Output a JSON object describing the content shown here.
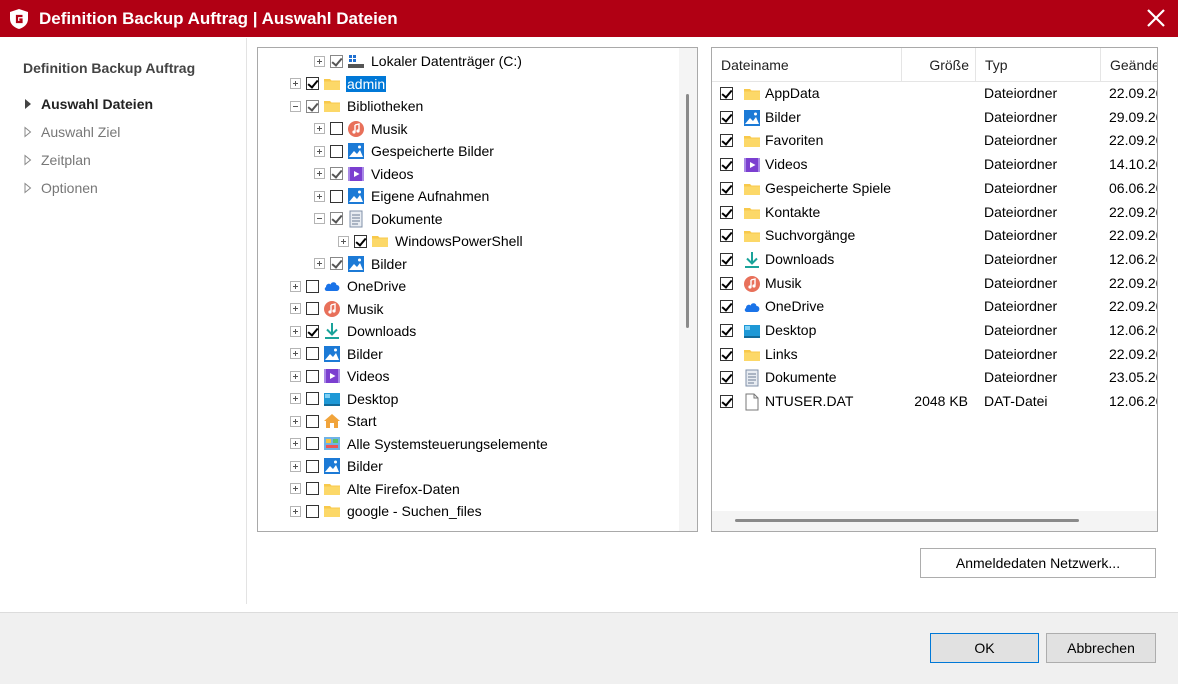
{
  "window": {
    "title": "Definition Backup Auftrag | Auswahl Dateien",
    "accent": "#b10014"
  },
  "nav": {
    "title": "Definition Backup Auftrag",
    "items": [
      {
        "label": "Auswahl Dateien",
        "active": true
      },
      {
        "label": "Auswahl Ziel"
      },
      {
        "label": "Zeitplan"
      },
      {
        "label": "Optionen"
      }
    ]
  },
  "tree": {
    "rows": [
      {
        "label": "Lokaler Datenträger (C:)",
        "icon": "drive-icon",
        "checked": true
      },
      {
        "label": "admin",
        "icon": "folder-icon",
        "checked": true,
        "selected": true
      },
      {
        "label": "Bibliotheken",
        "icon": "folder-icon",
        "checked": true
      },
      {
        "label": "Musik",
        "icon": "music-icon",
        "checked": false
      },
      {
        "label": "Gespeicherte Bilder",
        "icon": "pictures-icon",
        "checked": false
      },
      {
        "label": "Videos",
        "icon": "video-icon",
        "checked": true
      },
      {
        "label": "Eigene Aufnahmen",
        "icon": "pictures-icon",
        "checked": false
      },
      {
        "label": "Dokumente",
        "icon": "document-icon",
        "checked": true
      },
      {
        "label": "WindowsPowerShell",
        "icon": "folder-icon",
        "checked": true
      },
      {
        "label": "Bilder",
        "icon": "pictures-icon",
        "checked": true
      },
      {
        "label": "OneDrive",
        "icon": "cloud-icon",
        "checked": false
      },
      {
        "label": "Musik",
        "icon": "music-icon",
        "checked": false
      },
      {
        "label": "Downloads",
        "icon": "download-icon",
        "checked": true
      },
      {
        "label": "Bilder",
        "icon": "pictures-icon",
        "checked": false
      },
      {
        "label": "Videos",
        "icon": "video-icon",
        "checked": false
      },
      {
        "label": "Desktop",
        "icon": "desktop-icon",
        "checked": false
      },
      {
        "label": "Start",
        "icon": "home-icon",
        "checked": false
      },
      {
        "label": "Alle Systemsteuerungselemente",
        "icon": "control-panel-icon",
        "checked": false
      },
      {
        "label": "Bilder",
        "icon": "pictures-icon",
        "checked": false
      },
      {
        "label": "Alte Firefox-Daten",
        "icon": "folder-icon",
        "checked": false
      },
      {
        "label": "google - Suchen_files",
        "icon": "folder-icon",
        "checked": false
      }
    ]
  },
  "list": {
    "columns": [
      "Dateiname",
      "Größe",
      "Typ",
      "Geände"
    ],
    "rows": [
      {
        "name": "AppData",
        "size": "",
        "type": "Dateiordner",
        "date": "22.09.20",
        "icon": "folder-icon"
      },
      {
        "name": "Bilder",
        "size": "",
        "type": "Dateiordner",
        "date": "29.09.20",
        "icon": "pictures-icon"
      },
      {
        "name": "Favoriten",
        "size": "",
        "type": "Dateiordner",
        "date": "22.09.20",
        "icon": "folder-icon"
      },
      {
        "name": "Videos",
        "size": "",
        "type": "Dateiordner",
        "date": "14.10.20",
        "icon": "video-icon"
      },
      {
        "name": "Gespeicherte Spiele",
        "size": "",
        "type": "Dateiordner",
        "date": "06.06.20",
        "icon": "folder-icon"
      },
      {
        "name": "Kontakte",
        "size": "",
        "type": "Dateiordner",
        "date": "22.09.20",
        "icon": "folder-icon"
      },
      {
        "name": "Suchvorgänge",
        "size": "",
        "type": "Dateiordner",
        "date": "22.09.20",
        "icon": "folder-icon"
      },
      {
        "name": "Downloads",
        "size": "",
        "type": "Dateiordner",
        "date": "12.06.20",
        "icon": "download-icon"
      },
      {
        "name": "Musik",
        "size": "",
        "type": "Dateiordner",
        "date": "22.09.20",
        "icon": "music-icon"
      },
      {
        "name": "OneDrive",
        "size": "",
        "type": "Dateiordner",
        "date": "22.09.20",
        "icon": "cloud-icon"
      },
      {
        "name": "Desktop",
        "size": "",
        "type": "Dateiordner",
        "date": "12.06.20",
        "icon": "desktop-icon"
      },
      {
        "name": "Links",
        "size": "",
        "type": "Dateiordner",
        "date": "22.09.20",
        "icon": "folder-icon"
      },
      {
        "name": "Dokumente",
        "size": "",
        "type": "Dateiordner",
        "date": "23.05.20",
        "icon": "document-icon"
      },
      {
        "name": "NTUSER.DAT",
        "size": "2048 KB",
        "type": "DAT-Datei",
        "date": "12.06.20",
        "icon": "file-icon"
      }
    ]
  },
  "buttons": {
    "network": "Anmeldedaten Netzwerk...",
    "ok": "OK",
    "cancel": "Abbrechen"
  }
}
